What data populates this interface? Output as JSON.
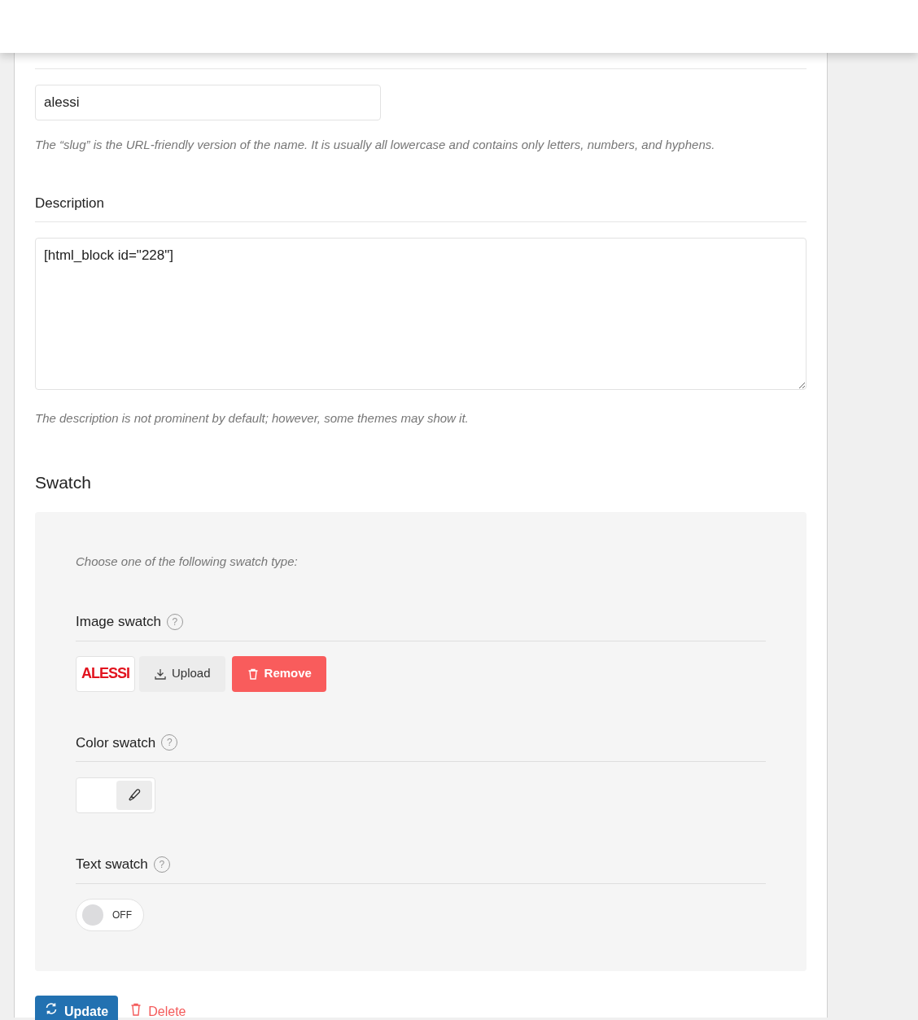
{
  "slug": {
    "value": "alessi",
    "help": "The “slug” is the URL-friendly version of the name. It is usually all lowercase and contains only letters, numbers, and hyphens."
  },
  "description": {
    "label": "Description",
    "value": "[html_block id=\"228\"]",
    "help": "The description is not prominent by default; however, some themes may show it."
  },
  "swatch": {
    "heading": "Swatch",
    "intro": "Choose one of the following swatch type:",
    "image_swatch": {
      "label": "Image swatch",
      "help_icon": "?",
      "logo": "ALESSI",
      "upload": "Upload",
      "remove": "Remove"
    },
    "color_swatch": {
      "label": "Color swatch",
      "help_icon": "?"
    },
    "text_swatch": {
      "label": "Text swatch",
      "help_icon": "?",
      "toggle": {
        "on": false,
        "label": "OFF"
      }
    }
  },
  "actions": {
    "update": "Update",
    "delete": "Delete"
  }
}
